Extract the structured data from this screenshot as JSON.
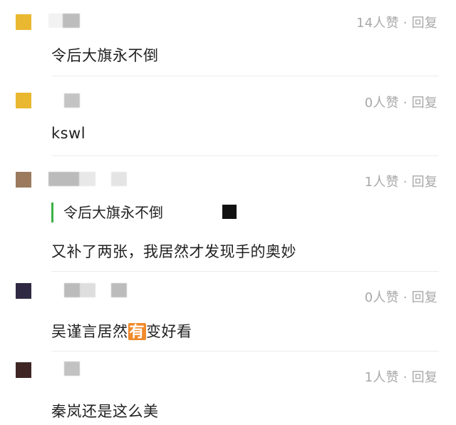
{
  "comments": [
    {
      "avatar_color": "#e9b830",
      "likes": "14人赞",
      "separator": "·",
      "reply": "回复",
      "text": "令后大旗永不倒"
    },
    {
      "avatar_color": "#e9b830",
      "likes": "0人赞",
      "separator": "·",
      "reply": "回复",
      "text": "kswl"
    },
    {
      "avatar_color": "#9c7a5e",
      "likes": "1人赞",
      "separator": "·",
      "reply": "回复",
      "quote": "令后大旗永不倒",
      "text": "又补了两张，我居然才发现手的奥妙"
    },
    {
      "avatar_color": "#2f2944",
      "likes": "0人赞",
      "separator": "·",
      "reply": "回复",
      "text_before": "吴谨言居然",
      "badge": "有",
      "text_after": "变好看"
    },
    {
      "avatar_color": "#3f2625",
      "likes": "1人赞",
      "separator": "·",
      "reply": "回复",
      "text": "秦岚还是这么美"
    }
  ],
  "colors": {
    "quote_bar": "#3cb045",
    "meta_text": "#a8a8a8",
    "badge_bg": "#f08a2c"
  }
}
